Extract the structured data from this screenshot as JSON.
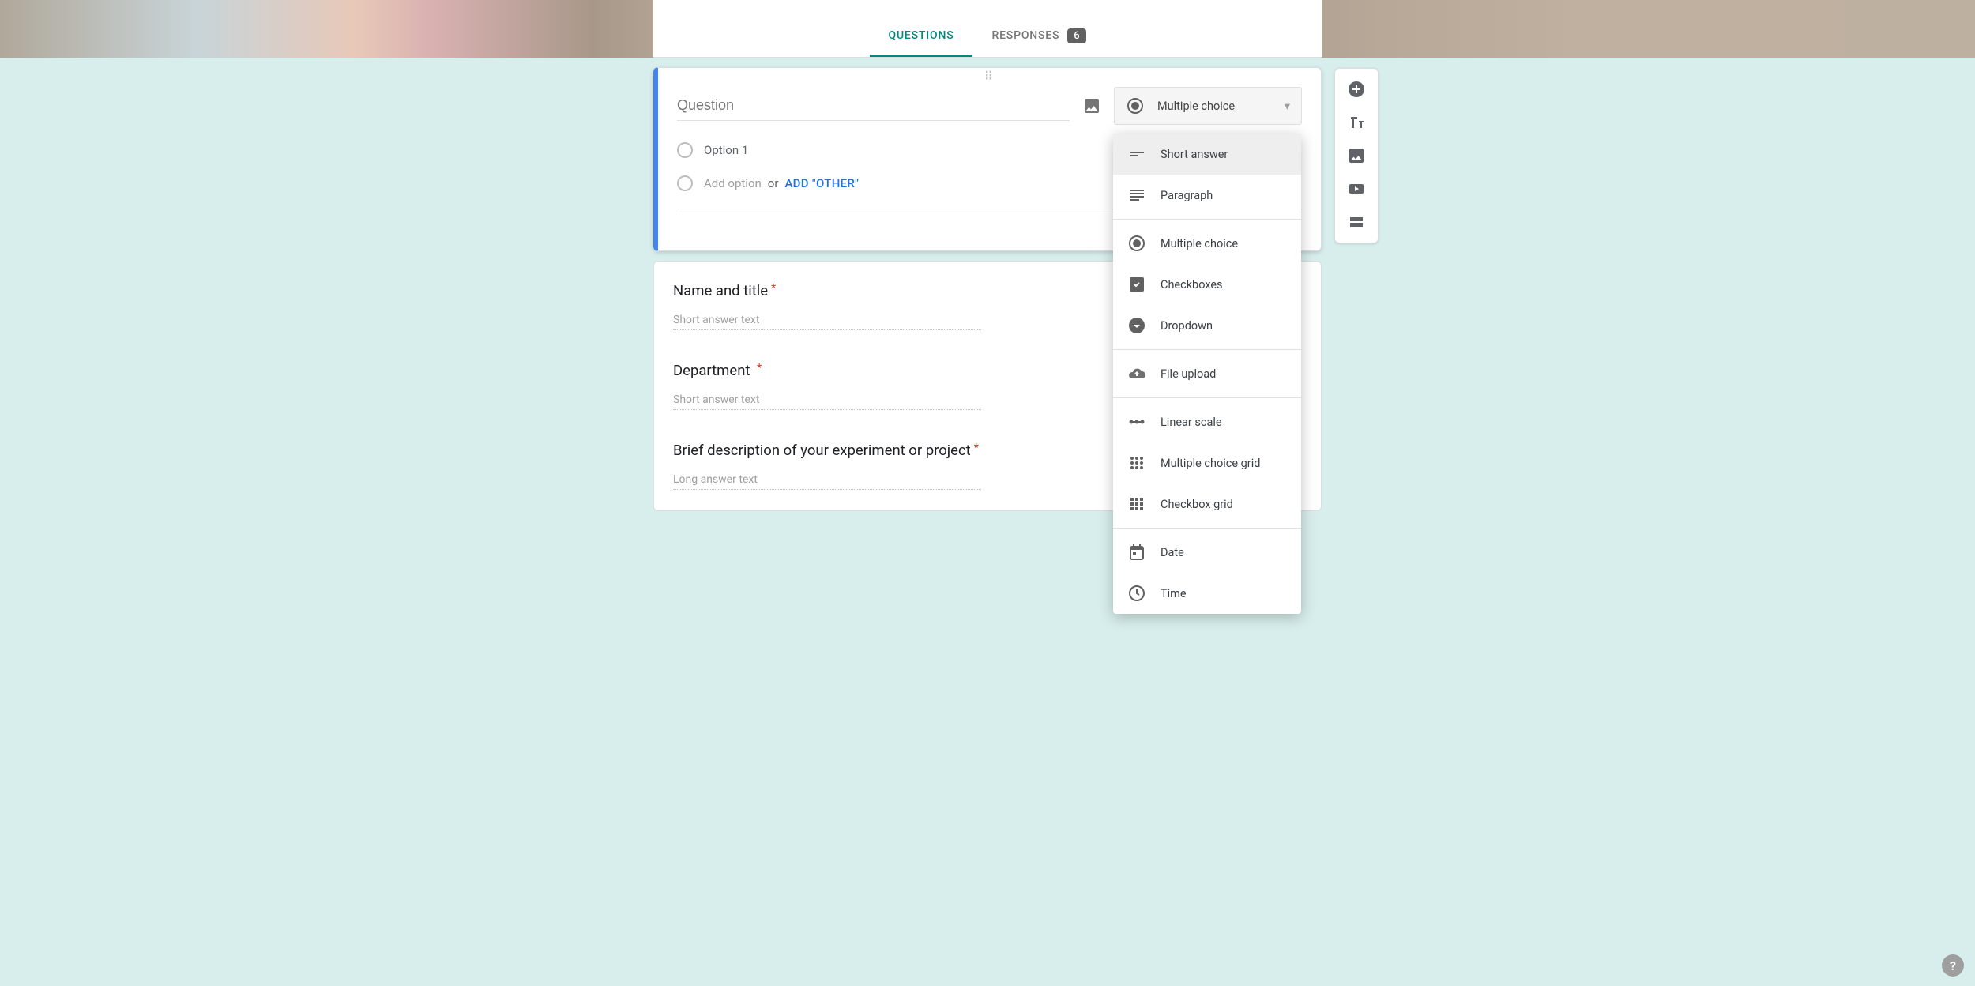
{
  "tabs": {
    "questions": "QUESTIONS",
    "responses": "RESPONSES",
    "response_count": "6"
  },
  "editor": {
    "question_placeholder": "Question",
    "selected_type": "Multiple choice",
    "option1": "Option 1",
    "add_option": "Add option",
    "or": "or",
    "add_other": "ADD \"OTHER\""
  },
  "type_menu": {
    "short_answer": "Short answer",
    "paragraph": "Paragraph",
    "multiple_choice": "Multiple choice",
    "checkboxes": "Checkboxes",
    "dropdown": "Dropdown",
    "file_upload": "File upload",
    "linear_scale": "Linear scale",
    "mc_grid": "Multiple choice grid",
    "checkbox_grid": "Checkbox grid",
    "date": "Date",
    "time": "Time"
  },
  "questions": {
    "q1": {
      "title": "Name and title",
      "placeholder": "Short answer text",
      "required": true
    },
    "q2": {
      "title": "Department",
      "placeholder": "Short answer text",
      "required": true
    },
    "q3": {
      "title": "Brief description of your experiment or project",
      "placeholder": "Long answer text",
      "required": true
    }
  }
}
